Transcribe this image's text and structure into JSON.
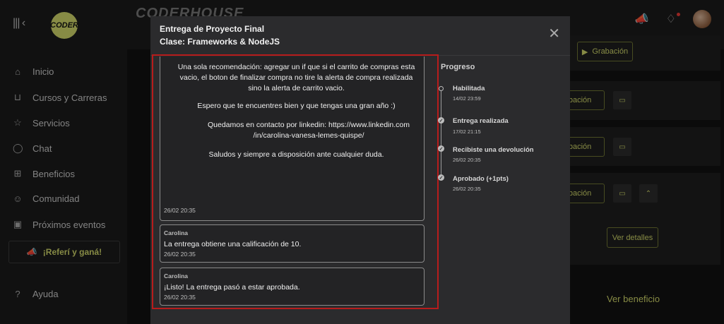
{
  "app": {
    "brand": "CODER",
    "brand_background": "CODERHOUSE"
  },
  "sidebar": {
    "items": [
      {
        "icon": "home-icon",
        "label": "Inicio"
      },
      {
        "icon": "cart-icon",
        "label": "Cursos y Carreras"
      },
      {
        "icon": "star-icon",
        "label": "Servicios"
      },
      {
        "icon": "chat-icon",
        "label": "Chat"
      },
      {
        "icon": "gift-icon",
        "label": "Beneficios"
      },
      {
        "icon": "community-icon",
        "label": "Comunidad"
      },
      {
        "icon": "calendar-icon",
        "label": "Próximos eventos"
      }
    ],
    "referral": "¡Referí y ganá!",
    "help": "Ayuda"
  },
  "background": {
    "recording_label": "Grabación",
    "recording_partial": "abación",
    "details_label": "Ver detalles",
    "benefit_link": "Ver beneficio"
  },
  "modal": {
    "title_line1": "Entrega de Proyecto Final",
    "title_line2": "Clase: Frameworks & NodeJS",
    "close": "✕",
    "main_message": {
      "paragraphs": [
        "Una sola recomendación: agregar un if que si el carrito de compras esta vacio, el boton de finalizar compra no tire la alerta de compra realizada sino la alerta de carrito vacio.",
        "Espero que te encuentres bien y que tengas una gran año :)",
        "Quedamos en contacto por linkedin:  https://www.linkedin.com /in/carolina-vanesa-lemes-quispe/",
        "Saludos y siempre a disposición ante cualquier duda."
      ],
      "time": "26/02 20:35"
    },
    "messages": [
      {
        "author": "Carolina",
        "body": "La entrega obtiene una calificación de 10.",
        "time": "26/02 20:35"
      },
      {
        "author": "Carolina",
        "body": "¡Listo! La entrega pasó a estar aprobada.",
        "time": "26/02 20:35"
      }
    ],
    "progress": {
      "title": "Progreso",
      "steps": [
        {
          "label": "Habilitada",
          "date": "14/02 23:59"
        },
        {
          "label": "Entrega realizada",
          "date": "17/02 21:15"
        },
        {
          "label": "Recibiste una devolución",
          "date": "26/02 20:35"
        },
        {
          "label": "Aprobado (+1pts)",
          "date": "26/02 20:35"
        }
      ]
    }
  },
  "colors": {
    "accent": "#cfd66a",
    "highlight": "#b71c1c",
    "modal_bg": "#2b2b2d"
  }
}
